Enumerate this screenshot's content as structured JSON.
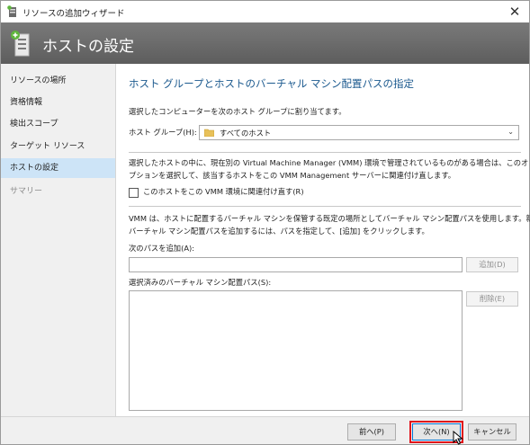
{
  "window": {
    "title": "リソースの追加ウィザード",
    "close_glyph": "✕"
  },
  "header": {
    "title": "ホストの設定"
  },
  "nav": {
    "items": [
      {
        "label": "リソースの場所"
      },
      {
        "label": "資格情報"
      },
      {
        "label": "検出スコープ"
      },
      {
        "label": "ターゲット リソース"
      },
      {
        "label": "ホストの設定"
      },
      {
        "label": "サマリー"
      }
    ],
    "active_index": 4
  },
  "content": {
    "title": "ホスト グループとホストのバーチャル マシン配置パスの指定",
    "assign_text": "選択したコンピューターを次のホスト グループに割り当てます。",
    "host_group_label": "ホスト グループ(H):",
    "host_group_value": "すべてのホスト",
    "vmm_text_1": "選択したホストの中に、現在別の Virtual Machine Manager (VMM) 環境で管理されているものがある場合は、このオ",
    "vmm_text_2": "プションを選択して、該当するホストをこの VMM Management サーバーに関連付け直します。",
    "reassociate_label": "このホストをこの VMM 環境に関連付け直す(R)",
    "path_text_1": "VMM は、ホストに配置するバーチャル マシンを保管する既定の場所としてバーチャル マシン配置パスを使用します。新しい",
    "path_text_2": "バーチャル マシン配置パスを追加するには、パスを指定して、[追加] をクリックします。",
    "add_path_label": "次のパスを追加(A):",
    "add_path_value": "",
    "add_button": "追加(D)",
    "selected_paths_label": "選択済みのバーチャル マシン配置パス(S):",
    "remove_button": "削除(E)"
  },
  "footer": {
    "prev_button": "前へ(P)",
    "next_button": "次へ(N)",
    "cancel_button": "キャンセル"
  },
  "colors": {
    "accent": "#1c5a8f",
    "highlight": "#e0111a",
    "active_nav": "#cde4f7"
  },
  "icons": {
    "app": "wizard-host-icon",
    "header": "host-server-icon",
    "folder": "folder-icon",
    "dropdown": "chevron-down-icon"
  }
}
